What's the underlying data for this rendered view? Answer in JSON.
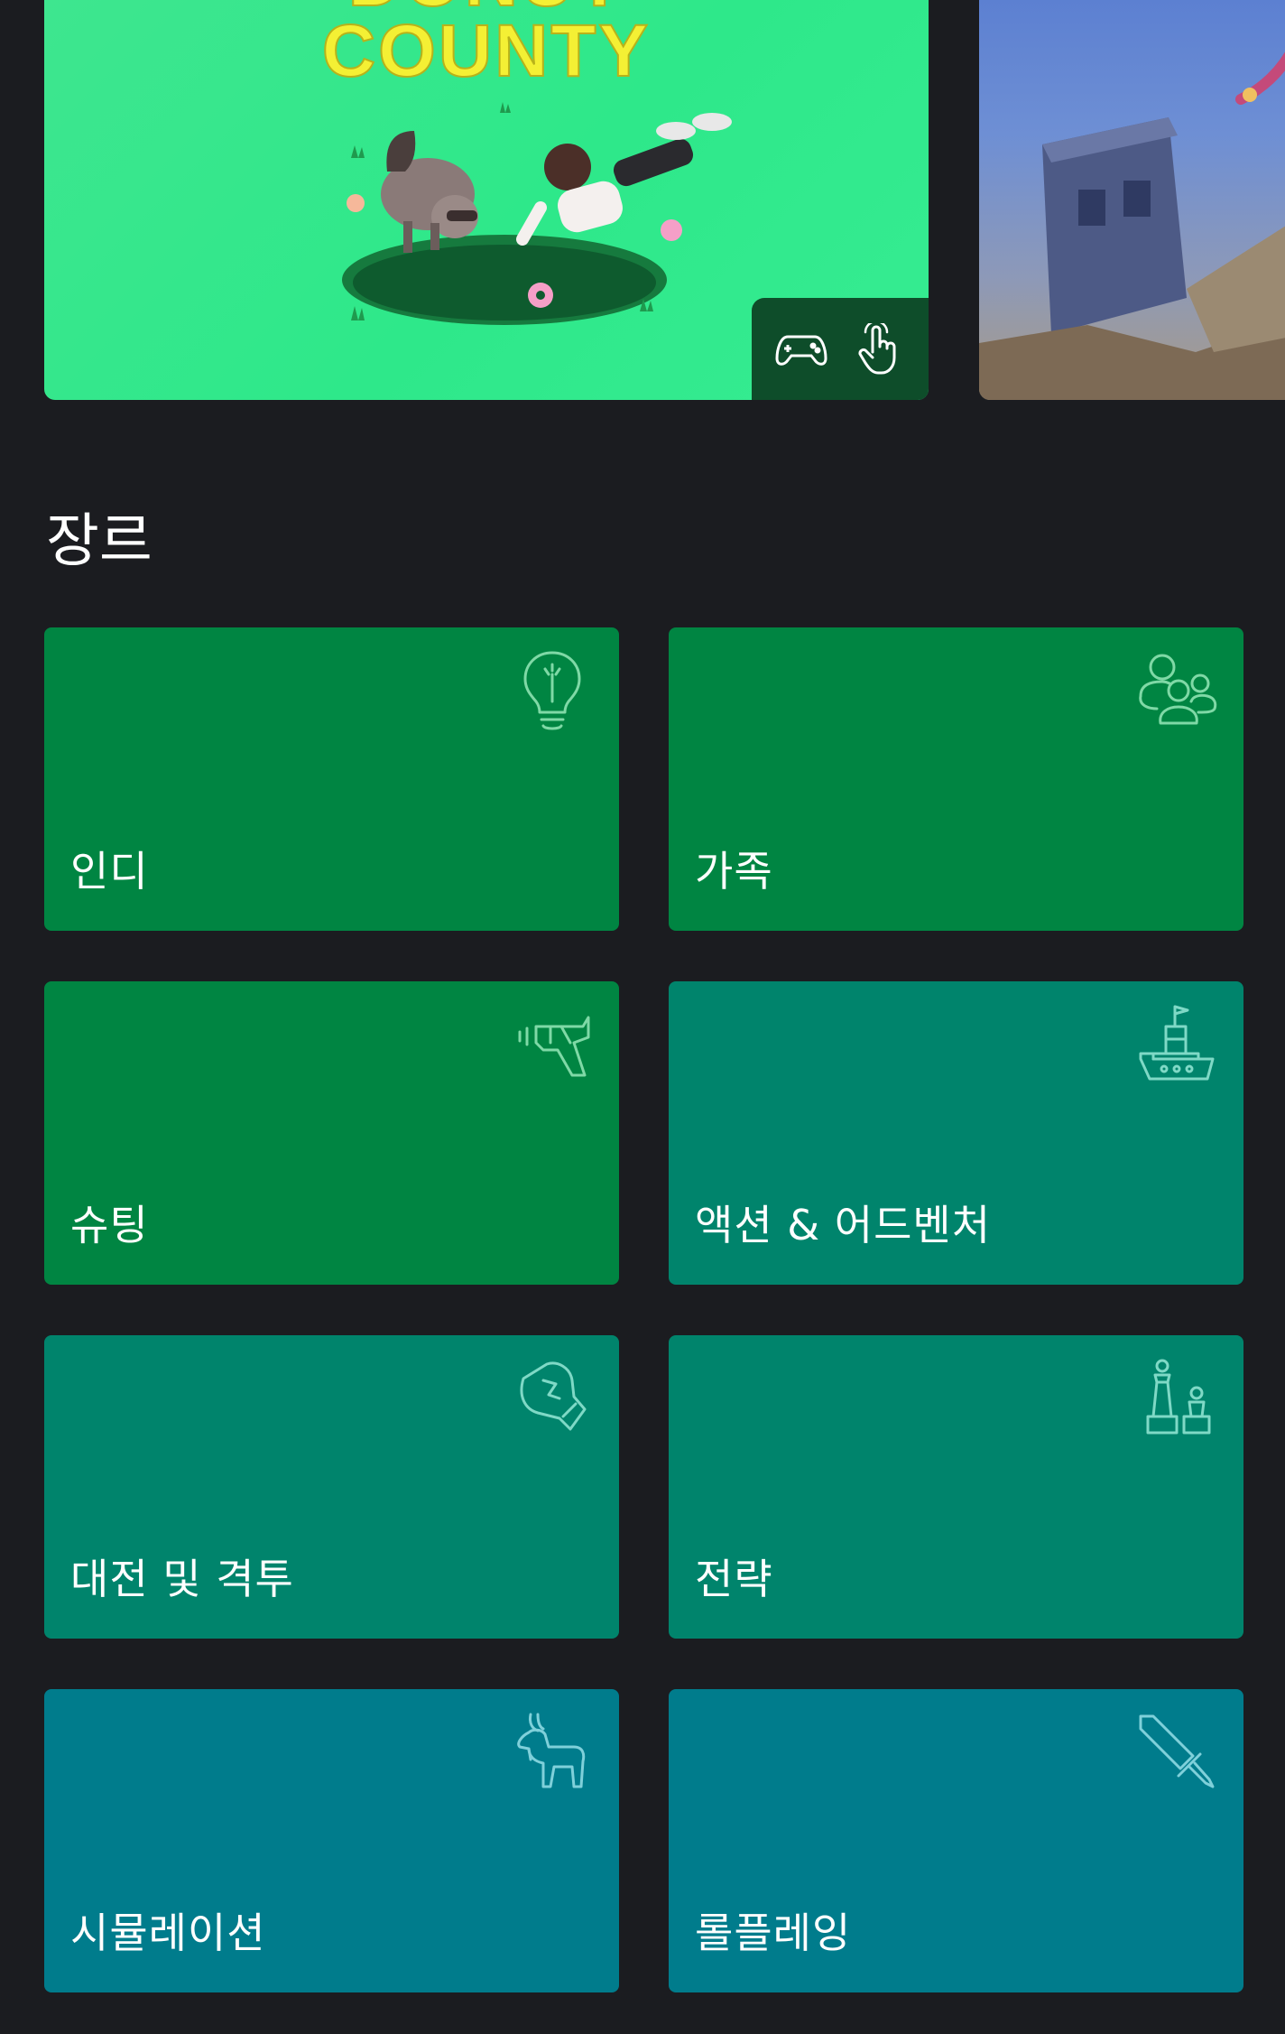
{
  "carousel": {
    "featured_game": {
      "logo_line1": "DONUT",
      "logo_line2": "COUNTY",
      "platform_icons": [
        "controller-icon",
        "touch-icon"
      ]
    },
    "next_card_icon": "game-artwork"
  },
  "genres": {
    "title": "장르",
    "items": [
      {
        "label": "인디",
        "icon": "lightbulb-icon",
        "color": "#008542"
      },
      {
        "label": "가족",
        "icon": "family-icon",
        "color": "#008542"
      },
      {
        "label": "슈팅",
        "icon": "blaster-icon",
        "color": "#008542"
      },
      {
        "label": "액션 & 어드벤처",
        "icon": "ship-icon",
        "color": "#00846c"
      },
      {
        "label": "대전 및 격투",
        "icon": "boxing-glove-icon",
        "color": "#00846c"
      },
      {
        "label": "전략",
        "icon": "chess-icon",
        "color": "#00846c"
      },
      {
        "label": "시뮬레이션",
        "icon": "goat-icon",
        "color": "#007c8c"
      },
      {
        "label": "롤플레잉",
        "icon": "sword-icon",
        "color": "#007c8c"
      }
    ]
  },
  "colors": {
    "background": "#1b1c20",
    "badge": "#0e4d2a"
  }
}
